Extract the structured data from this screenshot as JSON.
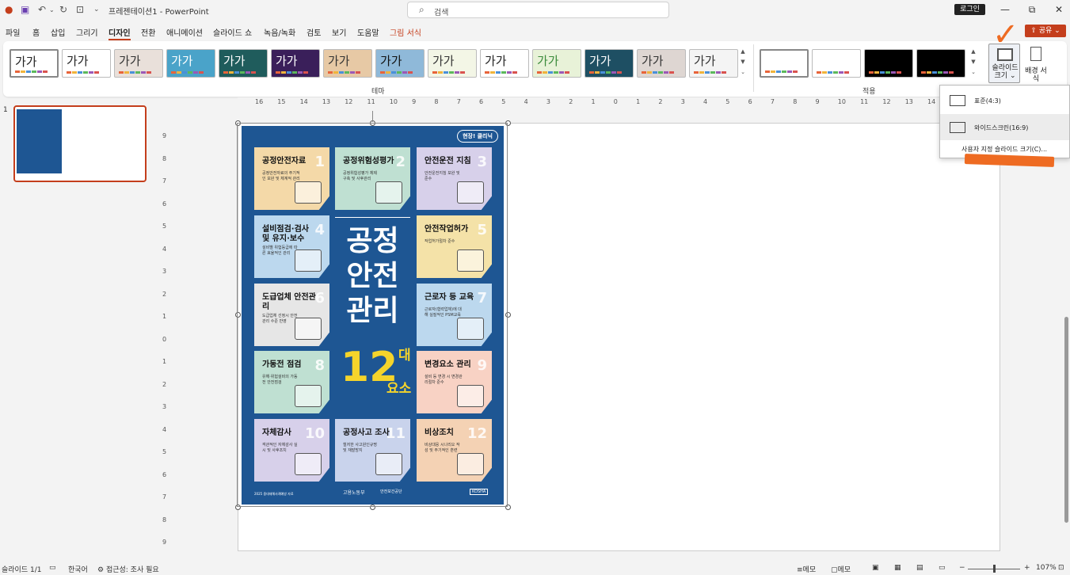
{
  "app": {
    "doc_title": "프레젠테이션1",
    "separator": "-",
    "app_name": "PowerPoint",
    "search_placeholder": "검색",
    "login_label": "로그인",
    "share_label": "공유"
  },
  "menu": [
    "파일",
    "홈",
    "삽입",
    "그리기",
    "디자인",
    "전환",
    "애니메이션",
    "슬라이드 쇼",
    "녹음/녹화",
    "검토",
    "보기",
    "도움말",
    "그림 서식"
  ],
  "ribbon": {
    "theme_sample": "가가",
    "themes_group_label": "테마",
    "variants_group_label": "적용",
    "slide_size_label": "슬라이드 크기",
    "slide_size_caret": "⌄",
    "bg_format_label": "배경 서식",
    "theme_colors": [
      {
        "bg": "#ffffff",
        "fg": "#222222"
      },
      {
        "bg": "#ffffff",
        "fg": "#222222"
      },
      {
        "bg": "#e9e0da",
        "fg": "#333333"
      },
      {
        "bg": "#4aa3c9",
        "fg": "#ffffff"
      },
      {
        "bg": "#1f5c5c",
        "fg": "#ffffff"
      },
      {
        "bg": "#3a1f5a",
        "fg": "#ffffff"
      },
      {
        "bg": "#e7c9a5",
        "fg": "#333333"
      },
      {
        "bg": "#8fb9d9",
        "fg": "#111111"
      },
      {
        "bg": "#f3f6e6",
        "fg": "#333333"
      },
      {
        "bg": "#ffffff",
        "fg": "#222222"
      },
      {
        "bg": "#e8f2d8",
        "fg": "#3b8b3b"
      },
      {
        "bg": "#1e4f63",
        "fg": "#ffffff"
      },
      {
        "bg": "#ded6d2",
        "fg": "#333333"
      },
      {
        "bg": "#f4f4f4",
        "fg": "#333333"
      }
    ],
    "variant_colors": [
      "#ffffff",
      "#ffffff",
      "#000000",
      "#000000"
    ]
  },
  "slides_pane": {
    "slide_number": "1"
  },
  "ruler": {
    "h_ticks": [
      "16",
      "15",
      "14",
      "13",
      "12",
      "11",
      "10",
      "9",
      "8",
      "7",
      "6",
      "5",
      "4",
      "3",
      "2",
      "1",
      "0",
      "1",
      "2",
      "3",
      "4",
      "5",
      "6",
      "7",
      "8",
      "9",
      "10",
      "11",
      "12",
      "13",
      "14"
    ],
    "v_ticks": [
      "9",
      "8",
      "7",
      "6",
      "5",
      "4",
      "3",
      "2",
      "1",
      "0",
      "1",
      "2",
      "3",
      "4",
      "5",
      "6",
      "7",
      "8",
      "9"
    ]
  },
  "poster": {
    "brand": "현장! 클리닉",
    "title_lines": [
      "공정",
      "안전",
      "관리"
    ],
    "num": "12",
    "dae": "대",
    "yoso": "요소",
    "footer_left": "2025 중대재해사례예방 자료",
    "footer_mid": "고용노동부",
    "footer_kosha": "안전보건공단",
    "footer_right": "KOSHA",
    "cards": [
      {
        "n": "1",
        "title": "공정안전자료",
        "sub": "공정안전자료의 주기적인 보완 및 체계적 관리",
        "color": "#f4d9a8"
      },
      {
        "n": "2",
        "title": "공정위험성평가",
        "sub": "공정위험성평가 체제 구축 및 사후관리",
        "color": "#bfe0d2"
      },
      {
        "n": "3",
        "title": "안전운전 지침",
        "sub": "안전운전지침 보완 및 준수",
        "color": "#d7d0ea"
      },
      {
        "n": "4",
        "title": "설비점검·검사 및 유지·보수",
        "sub": "설비별 위험등급에 따른 효율적인 관리",
        "color": "#bcd8ee"
      },
      {
        "n": "5",
        "title": "안전작업허가",
        "sub": "작업허가절차 준수",
        "color": "#f4e2a8"
      },
      {
        "n": "6",
        "title": "도급업체 안전관리",
        "sub": "도급업체 선정시 안전관리 수준 반영",
        "color": "#e6e6e6"
      },
      {
        "n": "7",
        "title": "근로자 등 교육",
        "sub": "근로자(협력업체)에 대해 실질적인 PSM교육",
        "color": "#bcd8ee"
      },
      {
        "n": "8",
        "title": "가동전 점검",
        "sub": "유해·위험설비의 가동 전 안전점검",
        "color": "#bfe0d2"
      },
      {
        "n": "9",
        "title": "변경요소 관리",
        "sub": "설비 등 변경 시 변경관리절차 준수",
        "color": "#f8d2c4"
      },
      {
        "n": "10",
        "title": "자체감사",
        "sub": "객관적인 자체감사 실시 및 사후조치",
        "color": "#d7d0ea"
      },
      {
        "n": "11",
        "title": "공정사고 조사",
        "sub": "철저한 사고원인규명 및 재발방지",
        "color": "#c9d3ec"
      },
      {
        "n": "12",
        "title": "비상조치",
        "sub": "비상대응 시나리오 작성 및 주기적인 훈련",
        "color": "#f4d2b4"
      }
    ]
  },
  "dropdown": {
    "standard": "표준(4:3)",
    "widescreen": "와이드스크린(16:9)",
    "custom": "사용자 지정 슬라이드 크기(C)..."
  },
  "status": {
    "slide_info": "슬라이드 1/1",
    "language": "한국어",
    "accessibility": "접근성: 조사 필요",
    "notes": "메모",
    "comments": "메모",
    "zoom": "107%"
  },
  "colors": {
    "accent": "#c43e1c",
    "poster_bg": "#1e5693",
    "annotation": "#ee6b22"
  }
}
